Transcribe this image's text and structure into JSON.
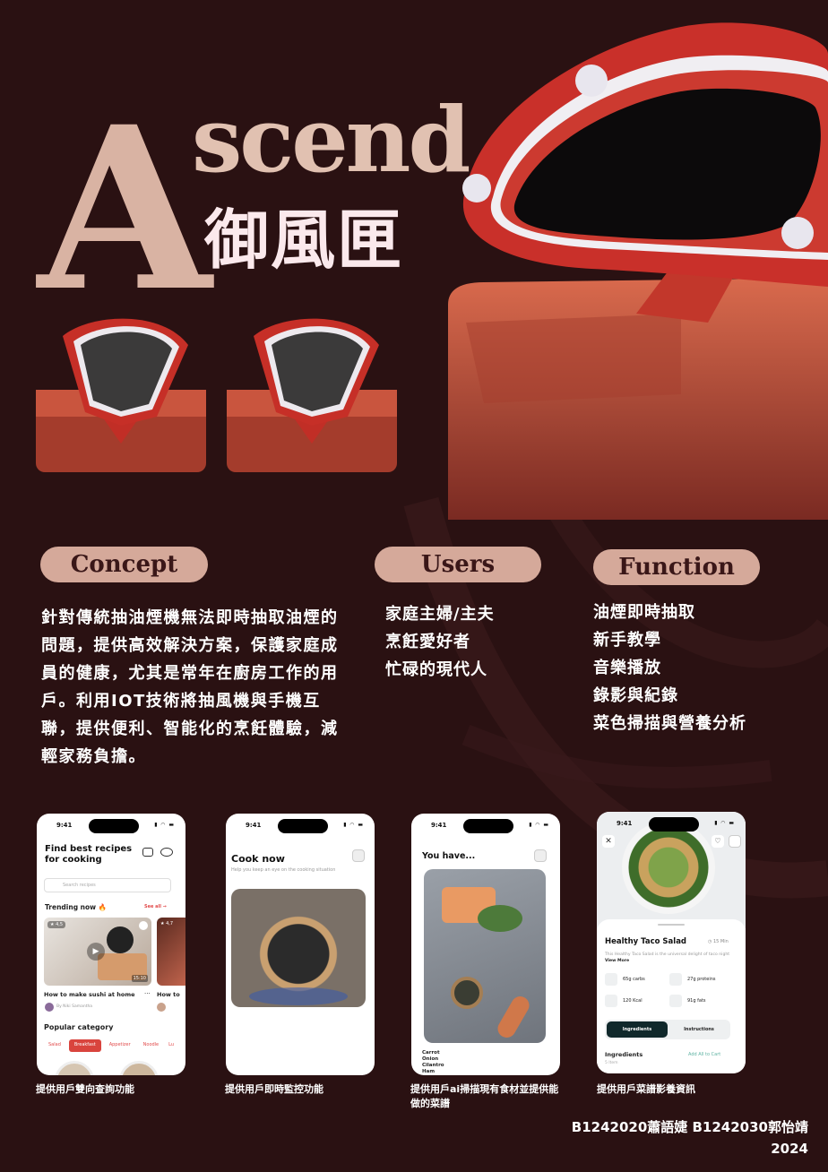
{
  "title": {
    "big_letter": "A",
    "rest": "scend",
    "chinese": "御風匣"
  },
  "sections": {
    "concept": {
      "label": "Concept",
      "text": "針對傳統抽油煙機無法即時抽取油煙的問題，提供高效解決方案，保護家庭成員的健康，尤其是常年在廚房工作的用戶。利用IOT技術將抽風機與手機互聯，提供便利、智能化的烹飪體驗，減輕家務負擔。"
    },
    "users": {
      "label": "Users",
      "items": [
        "家庭主婦/主夫",
        "烹飪愛好者",
        "忙碌的現代人"
      ]
    },
    "function": {
      "label": "Function",
      "items": [
        "油煙即時抽取",
        "新手教學",
        "音樂播放",
        "錄影與紀錄",
        "菜色掃描與營養分析"
      ]
    }
  },
  "phones": {
    "status_time": "9:41",
    "p1": {
      "title": "Find best recipes for cooking",
      "search_placeholder": "Search recipes",
      "trending": "Trending now 🔥",
      "see_all": "See all →",
      "rating": "★ 4,5",
      "rating2": "★ 4,7",
      "duration": "15:10",
      "card_title": "How to make sushi at home",
      "card_title2": "How to",
      "author": "By Niki Samantha",
      "popular": "Popular category",
      "categories": [
        "Salad",
        "Breakfast",
        "Appetizer",
        "Noodle",
        "Lu"
      ]
    },
    "p2": {
      "title": "Cook now",
      "subtitle": "Help you keep an eye on the cooking situation"
    },
    "p3": {
      "title": "You have...",
      "ingredients": [
        "Carrot",
        "Onion",
        "Cilantro",
        "Ham"
      ]
    },
    "p4": {
      "title": "Healthy Taco Salad",
      "time": "◷ 15 Min",
      "desc": "This Healthy Taco Salad is the universal delight of taco night",
      "view_more": "View More",
      "carbs": "65g carbs",
      "proteins": "27g proteins",
      "kcal": "120 Kcal",
      "fats": "91g fats",
      "tab_ingredients": "Ingredients",
      "tab_instructions": "Instructions",
      "section": "Ingredients",
      "add_all": "Add All to Cart",
      "count": "5 Item"
    }
  },
  "captions": [
    "提供用戶雙向查詢功能",
    "提供用戶即時監控功能",
    "提供用戶ai掃描現有食材並提供能做的菜譜",
    "提供用戶菜譜影養資訊"
  ],
  "credits": {
    "names": "B1242020蕭語婕  B1242030郭怡靖",
    "year": "2024"
  },
  "colors": {
    "background": "#2a1112",
    "title_rose": "#d9b3a3",
    "pill": "#d5a99a",
    "product_red": "#d2352a",
    "base_orange": "#c4503a"
  }
}
